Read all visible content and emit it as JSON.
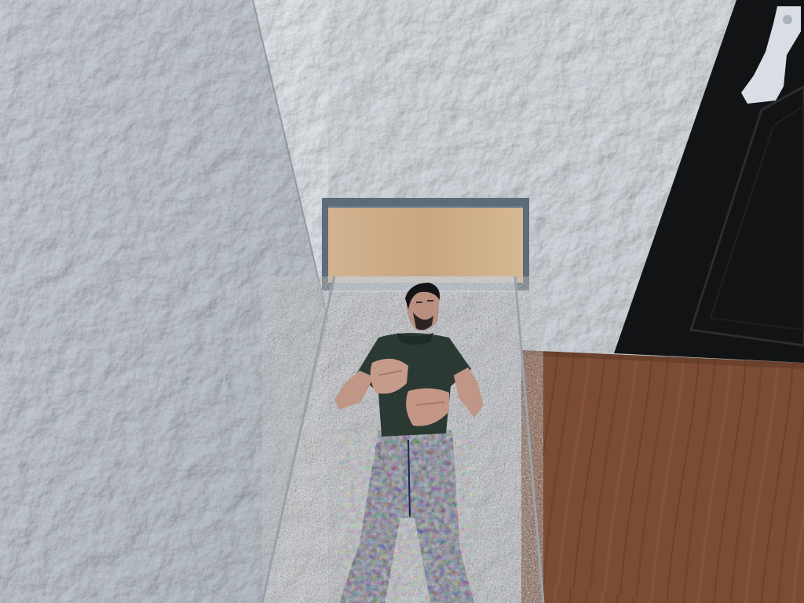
{
  "scene": {
    "colors": {
      "wall_left": "#9aa3ad",
      "wall_back": "#b3bac2",
      "floor_wood": "#7a4b33",
      "bed_frame": "#5f6e7c",
      "headboard_wood": "#c9a783",
      "mattress": "#b9c0c7",
      "door": "#141516",
      "door_handle": "#d7dde3",
      "shirt": "#2b3a33",
      "jeans": "#23367a",
      "skin": "#c49a8a",
      "hair": "#121314"
    }
  }
}
